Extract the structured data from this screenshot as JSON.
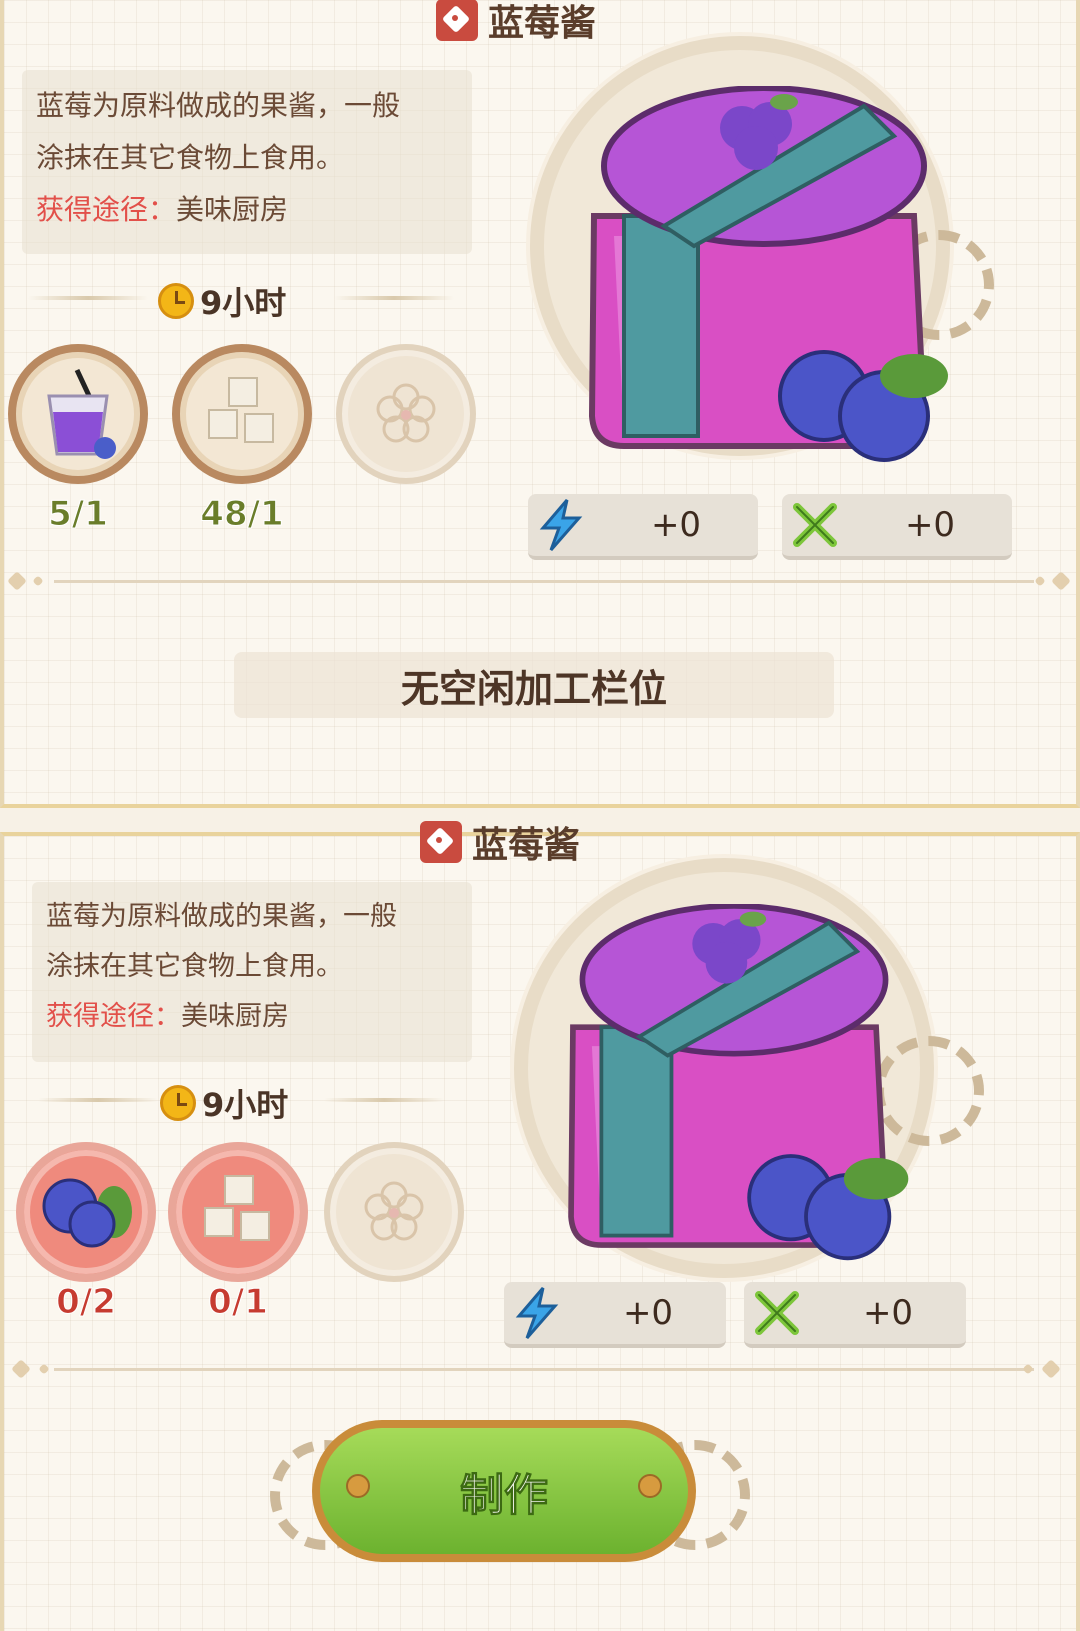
{
  "recipe_top": {
    "title": "蓝莓酱",
    "desc_line1": "蓝莓为原料做成的果酱，一般",
    "desc_line2": "涂抹在其它食物上食用。",
    "source_label": "获得途径：",
    "source_value": "美味厨房",
    "time": "9小时",
    "ingredients": [
      {
        "icon": "blueberry-juice-icon",
        "count": "5/1",
        "status": "enough"
      },
      {
        "icon": "sugar-cubes-icon",
        "count": "48/1",
        "status": "enough"
      },
      {
        "icon": "empty-slot-flower-icon",
        "count": "",
        "status": "empty"
      }
    ],
    "stats": [
      {
        "icon": "energy-bolt-icon",
        "value": "+0"
      },
      {
        "icon": "fork-spoon-icon",
        "value": "+0"
      }
    ]
  },
  "status_bar": {
    "text": "无空闲加工栏位"
  },
  "recipe_bottom": {
    "title": "蓝莓酱",
    "desc_line1": "蓝莓为原料做成的果酱，一般",
    "desc_line2": "涂抹在其它食物上食用。",
    "source_label": "获得途径：",
    "source_value": "美味厨房",
    "time": "9小时",
    "ingredients": [
      {
        "icon": "blueberries-icon",
        "count": "0/2",
        "status": "insufficient"
      },
      {
        "icon": "sugar-cubes-icon",
        "count": "0/1",
        "status": "insufficient"
      },
      {
        "icon": "empty-slot-flower-icon",
        "count": "",
        "status": "empty"
      }
    ],
    "stats": [
      {
        "icon": "energy-bolt-icon",
        "value": "+0"
      },
      {
        "icon": "fork-spoon-icon",
        "value": "+0"
      }
    ]
  },
  "make_button": {
    "label": "制作"
  },
  "colors": {
    "jam_pink": "#d94fc4",
    "lid_purple": "#b655d6",
    "ribbon_teal": "#4f9aa0",
    "button_green": "#86c73e",
    "insufficient_red": "#c63b30",
    "enough_green": "#6a7d2a"
  }
}
